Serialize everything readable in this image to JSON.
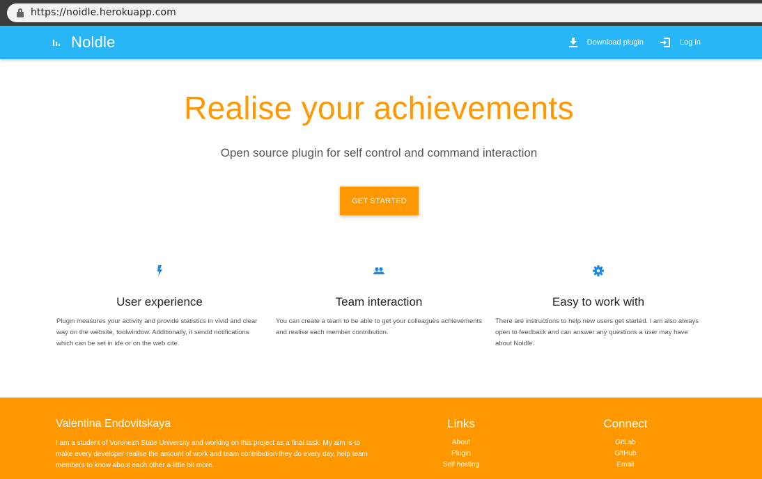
{
  "browser": {
    "url": "https://noidle.herokuapp.com"
  },
  "header": {
    "title": "Noldle",
    "download_label": "Download plugin",
    "login_label": "Log in",
    "background_color": "#29b6f6"
  },
  "hero": {
    "title": "Realise your achievements",
    "subtitle": "Open source plugin for self control and command interaction",
    "cta_label": "GET STARTED",
    "accent_color": "#ff9800"
  },
  "features": [
    {
      "icon": "flash-icon",
      "title": "User experience",
      "text": "Plugin measures your activity and provide statistics in vivid and clear way on the website, toolwindow. Additionally, it sendd notifications which can be set in ide or on the web cite."
    },
    {
      "icon": "people-icon",
      "title": "Team interaction",
      "text": "You can create a team to be able to get your colleagues achievements and realise each member contribution."
    },
    {
      "icon": "gear-icon",
      "title": "Easy to work with",
      "text": "There are instructions to help new users get started. I am also always open to feedback and can answer any questions a user may have about Noldle."
    }
  ],
  "footer": {
    "name": "Valentina Endovitskaya",
    "bio": "I am a student of Voronezh State University and working on this project as a final task. My aim is to make every developer realise the amount of work and team contribution they do every day, help team members to know about each other a little bit more.",
    "links_title": "Links",
    "links": [
      "About",
      "Plugin",
      "Self hosting"
    ],
    "connect_title": "Connect",
    "connect": [
      "GitLab",
      "GitHub",
      "Email"
    ],
    "background_color": "#ff9800"
  }
}
